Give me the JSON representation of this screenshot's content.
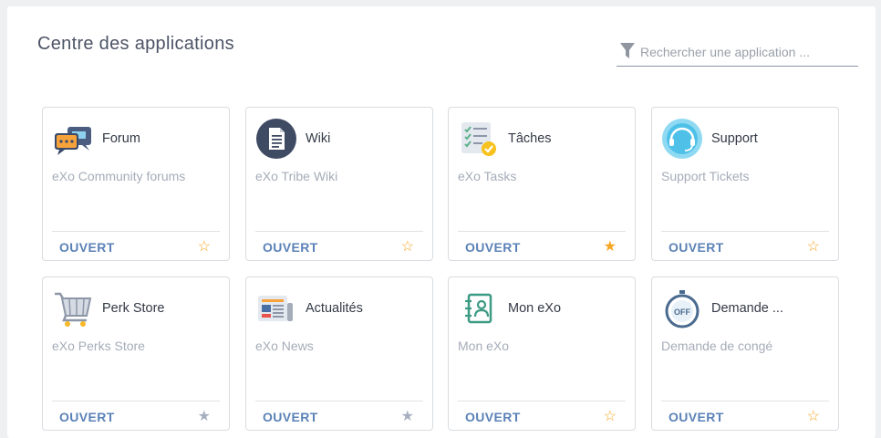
{
  "header": {
    "title": "Centre des applications",
    "search_placeholder": "Rechercher une application ..."
  },
  "colors": {
    "accent": "#5b82b7",
    "favorite": "#f5a623",
    "not_favorable": "#a8b0c0"
  },
  "apps": [
    {
      "title": "Forum",
      "description": "eXo Community forums",
      "open_label": "OUVERT",
      "favorite": "none",
      "icon": "forum-icon"
    },
    {
      "title": "Wiki",
      "description": "eXo Tribe Wiki",
      "open_label": "OUVERT",
      "favorite": "none",
      "icon": "wiki-icon"
    },
    {
      "title": "Tâches",
      "description": "eXo Tasks",
      "open_label": "OUVERT",
      "favorite": "favorite",
      "icon": "tasks-icon"
    },
    {
      "title": "Support",
      "description": "Support Tickets",
      "open_label": "OUVERT",
      "favorite": "none",
      "icon": "support-icon"
    },
    {
      "title": "Perk Store",
      "description": "eXo Perks Store",
      "open_label": "OUVERT",
      "favorite": "mandatory",
      "icon": "cart-icon"
    },
    {
      "title": "Actualités",
      "description": "eXo News",
      "open_label": "OUVERT",
      "favorite": "mandatory",
      "icon": "news-icon"
    },
    {
      "title": "Mon eXo",
      "description": "Mon eXo",
      "open_label": "OUVERT",
      "favorite": "none",
      "icon": "profile-icon"
    },
    {
      "title": "Demande ...",
      "description": "Demande de congé",
      "open_label": "OUVERT",
      "favorite": "none",
      "icon": "off-timer-icon"
    }
  ]
}
